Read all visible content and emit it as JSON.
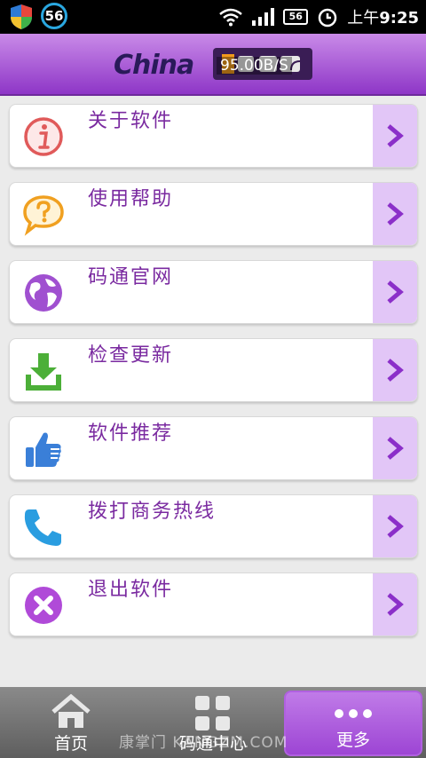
{
  "status_bar": {
    "badge": "56",
    "battery": "56",
    "time_prefix": "上午",
    "time": "9:25"
  },
  "header": {
    "logo_text": "China",
    "net_speed": "95.00B/S"
  },
  "menu": [
    {
      "label": "关于软件",
      "icon": "info-icon",
      "color": "#e05a5a"
    },
    {
      "label": "使用帮助",
      "icon": "help-icon",
      "color": "#f0a020"
    },
    {
      "label": "码通官网",
      "icon": "globe-icon",
      "color": "#a050d0"
    },
    {
      "label": "检查更新",
      "icon": "download-icon",
      "color": "#4caf38"
    },
    {
      "label": "软件推荐",
      "icon": "thumbs-up-icon",
      "color": "#3a7fd8"
    },
    {
      "label": "拨打商务热线",
      "icon": "phone-icon",
      "color": "#2a9de0"
    },
    {
      "label": "退出软件",
      "icon": "exit-icon",
      "color": "#b04ad8"
    }
  ],
  "tabs": [
    {
      "label": "首页",
      "icon": "home-icon"
    },
    {
      "label": "码通中心",
      "icon": "grid-icon"
    },
    {
      "label": "更多",
      "icon": "more-icon",
      "active": true
    }
  ],
  "watermark": "康掌门  KANGZM.COM",
  "colors": {
    "accent": "#9d45d4",
    "menu_text": "#7a2aa0",
    "arrow_bg": "#e2c6f7"
  }
}
